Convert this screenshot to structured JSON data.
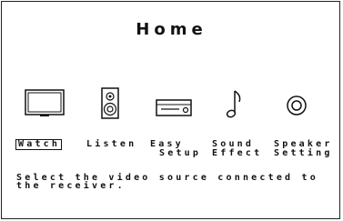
{
  "screen": {
    "title": "Home"
  },
  "menu": {
    "items": [
      {
        "id": "watch",
        "lines": [
          "Watch"
        ],
        "icon": "tv-icon",
        "selected": true
      },
      {
        "id": "listen",
        "lines": [
          "Listen"
        ],
        "icon": "speaker-icon",
        "selected": false
      },
      {
        "id": "easy-setup",
        "lines": [
          "Easy",
          "Setup"
        ],
        "icon": "receiver-icon",
        "selected": false
      },
      {
        "id": "sound-effect",
        "lines": [
          "Sound",
          "Effect"
        ],
        "icon": "music-note-icon",
        "selected": false
      },
      {
        "id": "speaker-setting",
        "lines": [
          "Speaker",
          "Setting"
        ],
        "icon": "disc-speaker-icon",
        "selected": false
      }
    ]
  },
  "message": {
    "lines": [
      "Select the video source connected to",
      "the receiver."
    ]
  },
  "colors": {
    "foreground": "#111111",
    "background": "#ffffff"
  }
}
